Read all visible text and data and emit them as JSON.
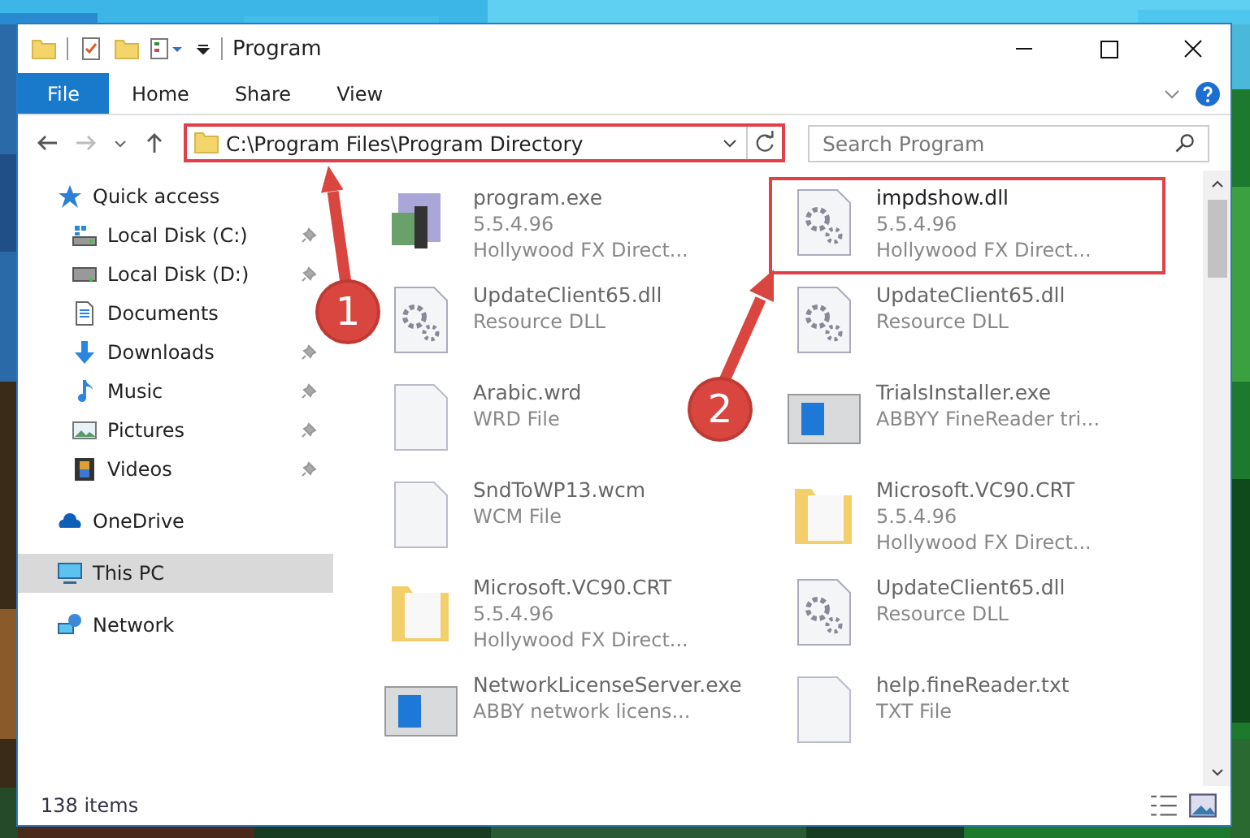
{
  "window": {
    "title": "Program"
  },
  "ribbon_tabs": [
    {
      "label": "File",
      "selected": true
    },
    {
      "label": "Home",
      "selected": false
    },
    {
      "label": "Share",
      "selected": false
    },
    {
      "label": "View",
      "selected": false
    }
  ],
  "address": {
    "value": "C:\\Program Files\\Program Directory",
    "highlighted": true
  },
  "search": {
    "placeholder": "Search Program"
  },
  "sidebar": {
    "items": [
      {
        "label": "Quick access",
        "kind": "star",
        "selected": false,
        "children": [
          {
            "label": "Local Disk (C:)",
            "kind": "diskc",
            "pinned": true,
            "selected": false
          },
          {
            "label": "Local Disk (D:)",
            "kind": "disk",
            "pinned": true,
            "selected": false
          },
          {
            "label": "Documents",
            "kind": "documents",
            "pinned": false,
            "selected": false
          },
          {
            "label": "Downloads",
            "kind": "downloads",
            "pinned": true,
            "selected": false
          },
          {
            "label": "Music",
            "kind": "music",
            "pinned": true,
            "selected": false
          },
          {
            "label": "Pictures",
            "kind": "pictures",
            "pinned": true,
            "selected": false
          },
          {
            "label": "Videos",
            "kind": "videos",
            "pinned": true,
            "selected": false
          }
        ]
      },
      {
        "label": "OneDrive",
        "kind": "onedrive",
        "selected": false
      },
      {
        "label": "This PC",
        "kind": "pc",
        "selected": true
      },
      {
        "label": "Network",
        "kind": "network",
        "selected": false
      }
    ]
  },
  "files": [
    {
      "name": "program.exe",
      "kind": "exe",
      "selected": false,
      "details": [
        "5.5.4.96",
        "Hollywood FX Direct..."
      ]
    },
    {
      "name": "impdshow.dll",
      "kind": "dll",
      "selected": true,
      "details": [
        "5.5.4.96",
        "Hollywood FX Direct..."
      ]
    },
    {
      "name": "UpdateClient65.dll",
      "kind": "dll",
      "selected": false,
      "details": [
        "Resource DLL"
      ]
    },
    {
      "name": "UpdateClient65.dll",
      "kind": "dll",
      "selected": false,
      "details": [
        "Resource DLL"
      ]
    },
    {
      "name": "Arabic.wrd",
      "kind": "blank",
      "selected": false,
      "details": [
        "WRD File"
      ]
    },
    {
      "name": "TrialsInstaller.exe",
      "kind": "window",
      "selected": false,
      "details": [
        "ABBYY FineReader tri..."
      ]
    },
    {
      "name": "SndToWP13.wcm",
      "kind": "blank",
      "selected": false,
      "details": [
        "WCM File"
      ]
    },
    {
      "name": "Microsoft.VC90.CRT",
      "kind": "folder",
      "selected": false,
      "details": [
        "5.5.4.96",
        "Hollywood FX Direct..."
      ]
    },
    {
      "name": "Microsoft.VC90.CRT",
      "kind": "folder",
      "selected": false,
      "details": [
        "5.5.4.96",
        "Hollywood FX Direct..."
      ]
    },
    {
      "name": "UpdateClient65.dll",
      "kind": "dll",
      "selected": false,
      "details": [
        "Resource DLL"
      ]
    },
    {
      "name": "NetworkLicenseServer.exe",
      "kind": "window",
      "selected": false,
      "details": [
        "ABBY network licens..."
      ]
    },
    {
      "name": "help.fineReader.txt",
      "kind": "blank",
      "selected": false,
      "details": [
        "TXT File"
      ]
    }
  ],
  "status_bar": {
    "item_count": "138 items"
  },
  "callouts": [
    {
      "number": "1"
    },
    {
      "number": "2"
    }
  ]
}
